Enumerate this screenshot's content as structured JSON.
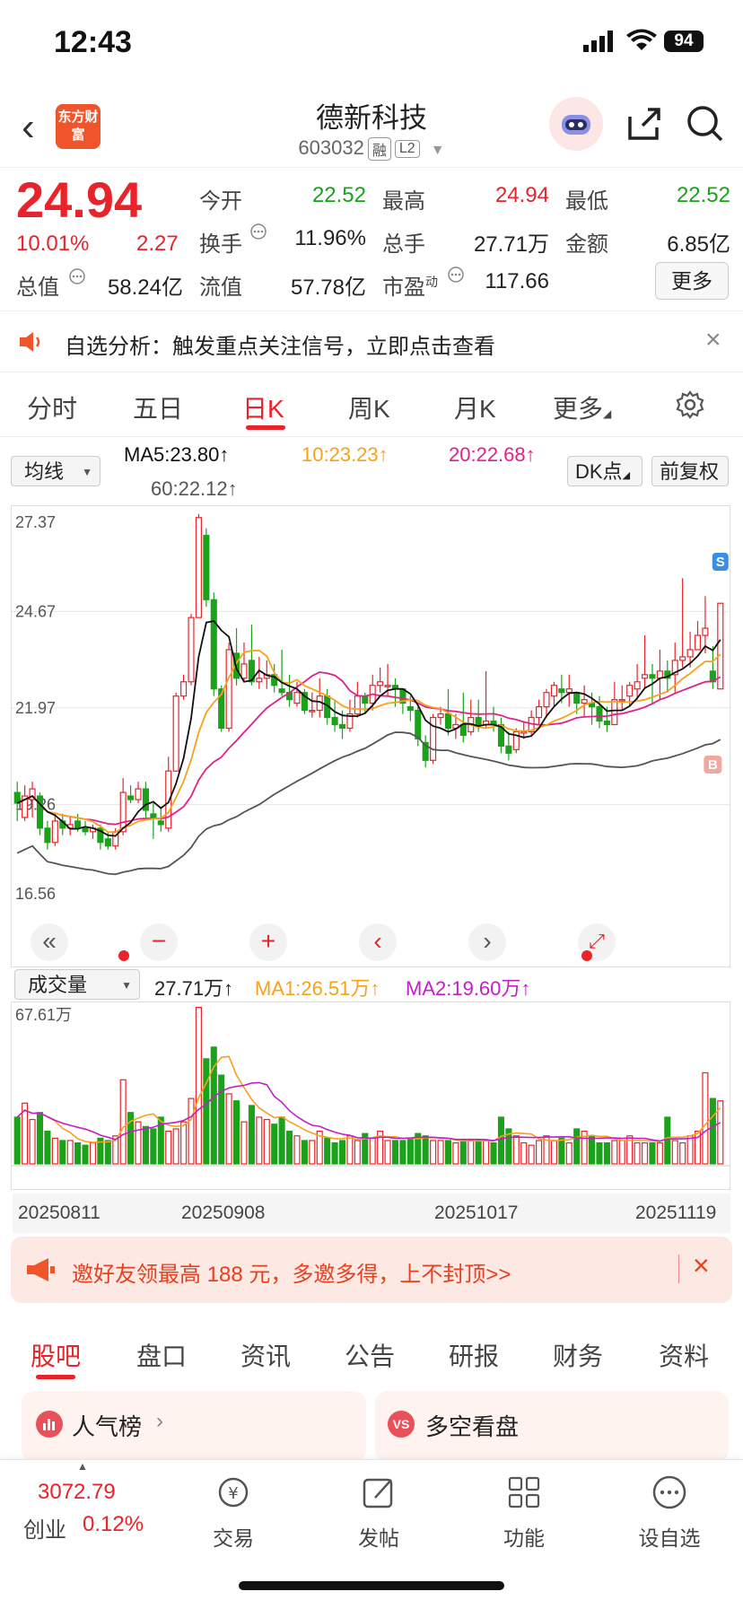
{
  "status": {
    "time": "12:43",
    "battery": "94"
  },
  "header": {
    "title": "德新科技",
    "code": "603032",
    "tag1": "融",
    "tag2": "L2",
    "logo": "东方财富"
  },
  "quote": {
    "price": "24.94",
    "change_pct": "10.01%",
    "change": "2.27",
    "open_label": "今开",
    "open": "22.52",
    "high_label": "最高",
    "high": "24.94",
    "low_label": "最低",
    "low": "22.52",
    "turnover_label": "换手",
    "turnover": "11.96%",
    "volume_label": "总手",
    "volume": "27.71万",
    "amount_label": "金额",
    "amount": "6.85亿",
    "mcap_label": "总值",
    "mcap": "58.24亿",
    "float_label": "流值",
    "float": "57.78亿",
    "pe_label": "市盈",
    "pe_sup": "动",
    "pe": "117.66",
    "more": "更多"
  },
  "notice": {
    "text": "自选分析：触发重点关注信号，立即点击查看"
  },
  "tabs": [
    "分时",
    "五日",
    "日K",
    "周K",
    "月K",
    "更多"
  ],
  "ma": {
    "select": "均线",
    "ma5": "MA5:23.80↑",
    "ma10": "10:23.23↑",
    "ma20": "20:22.68↑",
    "ma60": "60:22.12↑",
    "dk": "DK点",
    "fq": "前复权"
  },
  "chart_data": {
    "type": "candlestick",
    "y_ticks": [
      "27.37",
      "24.67",
      "21.97",
      "19.26",
      "16.56"
    ],
    "ylim": [
      16.56,
      27.37
    ],
    "markers": [
      "S",
      "B"
    ],
    "candles": [
      [
        19.6,
        19.3,
        19.9,
        18.8
      ],
      [
        18.9,
        19.5,
        19.8,
        18.8
      ],
      [
        19.4,
        19.7,
        19.9,
        18.9
      ],
      [
        19.5,
        18.6,
        19.6,
        18.4
      ],
      [
        18.6,
        18.2,
        18.8,
        18.0
      ],
      [
        18.2,
        18.8,
        19.0,
        18.1
      ],
      [
        18.8,
        18.6,
        19.0,
        18.4
      ],
      [
        18.6,
        18.7,
        18.9,
        18.4
      ],
      [
        18.8,
        18.6,
        19.0,
        18.5
      ],
      [
        18.6,
        18.5,
        18.8,
        18.4
      ],
      [
        18.5,
        18.6,
        18.7,
        18.3
      ],
      [
        18.6,
        18.2,
        18.7,
        18.0
      ],
      [
        18.3,
        18.1,
        18.5,
        18.0
      ],
      [
        18.1,
        18.5,
        18.6,
        18.0
      ],
      [
        18.5,
        19.6,
        20.0,
        18.4
      ],
      [
        19.5,
        19.4,
        19.8,
        19.3
      ],
      [
        19.4,
        19.7,
        19.9,
        19.3
      ],
      [
        19.7,
        19.1,
        19.9,
        18.9
      ],
      [
        19.0,
        18.9,
        19.3,
        18.3
      ],
      [
        18.8,
        18.7,
        19.2,
        18.5
      ],
      [
        18.6,
        20.2,
        20.6,
        18.5
      ],
      [
        20.2,
        22.3,
        22.4,
        20.2
      ],
      [
        22.3,
        22.7,
        22.9,
        22.2
      ],
      [
        22.7,
        24.5,
        24.6,
        22.6
      ],
      [
        24.5,
        27.3,
        27.4,
        25.6
      ],
      [
        26.8,
        25.0,
        27.0,
        24.8
      ],
      [
        25.0,
        22.5,
        25.2,
        22.3
      ],
      [
        22.5,
        21.4,
        22.6,
        21.3
      ],
      [
        21.4,
        23.6,
        23.8,
        21.3
      ],
      [
        23.5,
        22.8,
        24.2,
        22.6
      ],
      [
        22.8,
        23.2,
        23.8,
        22.7
      ],
      [
        23.3,
        22.7,
        24.3,
        22.6
      ],
      [
        22.7,
        22.8,
        23.4,
        22.5
      ],
      [
        22.8,
        22.9,
        23.3,
        22.5
      ],
      [
        22.9,
        22.6,
        23.2,
        22.4
      ],
      [
        22.5,
        22.4,
        23.6,
        22.3
      ],
      [
        22.4,
        22.2,
        22.9,
        22.0
      ],
      [
        22.1,
        22.4,
        22.7,
        22.0
      ],
      [
        22.4,
        21.9,
        22.5,
        21.8
      ],
      [
        21.9,
        21.9,
        22.4,
        21.7
      ],
      [
        21.9,
        22.3,
        22.8,
        21.7
      ],
      [
        22.3,
        21.7,
        22.5,
        21.5
      ],
      [
        21.7,
        21.5,
        22.2,
        21.3
      ],
      [
        21.5,
        21.4,
        21.9,
        21.1
      ],
      [
        21.4,
        21.8,
        22.2,
        21.3
      ],
      [
        21.8,
        22.3,
        22.7,
        21.7
      ],
      [
        22.3,
        22.1,
        22.4,
        21.8
      ],
      [
        22.1,
        22.6,
        22.9,
        21.9
      ],
      [
        22.6,
        22.7,
        23.1,
        22.4
      ],
      [
        22.6,
        22.6,
        23.2,
        22.3
      ],
      [
        22.6,
        22.5,
        22.8,
        22.0
      ],
      [
        22.5,
        22.1,
        22.5,
        21.8
      ],
      [
        22.0,
        21.9,
        22.3,
        21.6
      ],
      [
        21.9,
        21.1,
        22.0,
        20.9
      ],
      [
        21.0,
        20.5,
        21.2,
        20.3
      ],
      [
        20.5,
        21.7,
        21.8,
        20.4
      ],
      [
        21.7,
        21.8,
        22.0,
        21.5
      ],
      [
        21.8,
        21.4,
        22.5,
        21.2
      ],
      [
        21.4,
        21.5,
        21.8,
        21.1
      ],
      [
        21.5,
        21.2,
        22.4,
        21.0
      ],
      [
        21.3,
        21.7,
        22.2,
        21.2
      ],
      [
        21.7,
        21.5,
        22.2,
        21.3
      ],
      [
        21.5,
        21.6,
        23.0,
        21.4
      ],
      [
        21.6,
        21.5,
        22.0,
        21.3
      ],
      [
        21.5,
        20.9,
        21.7,
        20.7
      ],
      [
        20.9,
        20.7,
        21.3,
        20.5
      ],
      [
        20.8,
        21.3,
        21.4,
        20.7
      ],
      [
        21.3,
        21.3,
        21.6,
        21.1
      ],
      [
        21.3,
        21.7,
        21.9,
        21.2
      ],
      [
        21.7,
        22.0,
        22.2,
        21.5
      ],
      [
        22.0,
        22.4,
        22.5,
        21.7
      ],
      [
        22.3,
        22.6,
        22.7,
        22.0
      ],
      [
        22.5,
        22.4,
        22.9,
        22.1
      ],
      [
        22.4,
        22.5,
        22.9,
        22.0
      ],
      [
        22.4,
        22.1,
        22.4,
        21.8
      ],
      [
        22.1,
        22.2,
        22.6,
        21.7
      ],
      [
        22.1,
        22.0,
        22.4,
        21.5
      ],
      [
        22.0,
        21.6,
        22.3,
        21.4
      ],
      [
        21.6,
        21.5,
        22.0,
        21.3
      ],
      [
        21.5,
        22.2,
        22.7,
        21.5
      ],
      [
        22.2,
        22.2,
        22.6,
        21.9
      ],
      [
        22.3,
        22.6,
        22.7,
        22.0
      ],
      [
        22.5,
        22.7,
        23.2,
        22.2
      ],
      [
        22.8,
        22.9,
        24.0,
        22.5
      ],
      [
        22.9,
        22.8,
        23.2,
        22.1
      ],
      [
        22.8,
        23.0,
        23.6,
        22.2
      ],
      [
        23.0,
        22.8,
        23.3,
        22.4
      ],
      [
        22.9,
        23.3,
        23.8,
        22.4
      ],
      [
        23.3,
        23.4,
        25.6,
        23.1
      ],
      [
        23.4,
        23.6,
        24.1,
        23.1
      ],
      [
        23.6,
        24.0,
        24.4,
        23.6
      ],
      [
        24.0,
        24.2,
        25.1,
        23.5
      ],
      [
        23.0,
        22.7,
        23.7,
        22.5
      ],
      [
        22.5,
        24.9,
        24.9,
        22.5
      ]
    ],
    "ma_legend": [
      "MA5",
      "MA10",
      "MA20",
      "MA60"
    ],
    "volume": {
      "select": "成交量",
      "value": "27.71万↑",
      "ma1": "MA1:26.51万↑",
      "ma2": "MA2:19.60万↑",
      "max_label": "67.61万",
      "ylim": [
        0,
        67.61
      ],
      "values": [
        20,
        26,
        19,
        22,
        14,
        11,
        10,
        10,
        9,
        8,
        9,
        11,
        10,
        12,
        36,
        22,
        18,
        16,
        15,
        20,
        14,
        15,
        18,
        28,
        67,
        45,
        50,
        38,
        30,
        27,
        18,
        25,
        20,
        19,
        17,
        20,
        14,
        12,
        10,
        10,
        14,
        11,
        9,
        10,
        12,
        10,
        13,
        11,
        14,
        10,
        10,
        10,
        11,
        13,
        12,
        10,
        10,
        10,
        9,
        10,
        10,
        10,
        10,
        9,
        20,
        15,
        12,
        9,
        8,
        10,
        12,
        10,
        11,
        9,
        15,
        14,
        12,
        9,
        9,
        10,
        10,
        12,
        9,
        9,
        9,
        9,
        20,
        10,
        9,
        12,
        14,
        39,
        28,
        27
      ]
    },
    "x_labels": [
      "20250811",
      "20250908",
      "20251017",
      "20251119"
    ]
  },
  "invite": {
    "text": "邀好友领最高 188 元，多邀多得，上不封顶>>"
  },
  "bottom_tabs": [
    "股吧",
    "盘口",
    "资讯",
    "公告",
    "研报",
    "财务",
    "资料"
  ],
  "cards": {
    "card1": "人气榜",
    "card2": "多空看盘"
  },
  "footer": {
    "index": "3072.79",
    "index_name": "创业",
    "index_pct": "0.12%",
    "trade": "交易",
    "post": "发帖",
    "func": "功能",
    "watch": "设自选"
  },
  "colors": {
    "up": "#e8232a",
    "down": "#1aa31a",
    "ma5": "#111111",
    "ma10": "#f7a21b",
    "ma20": "#e0218a",
    "ma60": "#555555"
  }
}
